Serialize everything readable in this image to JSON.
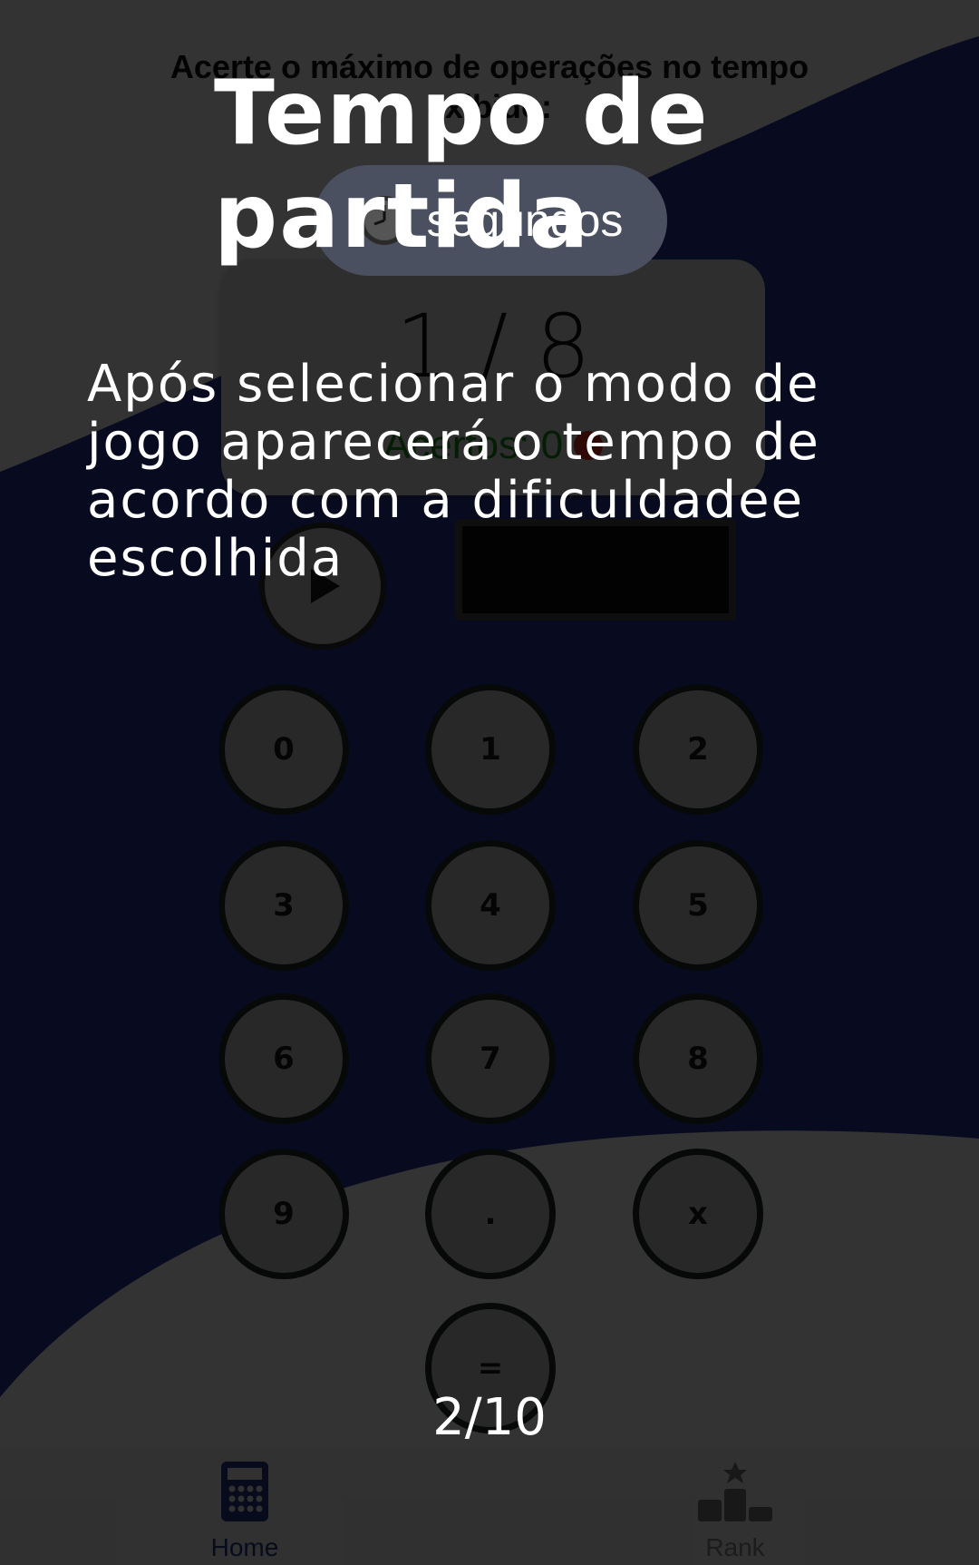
{
  "game": {
    "instruction": "Acerte o máximo de operações no tempo exibido:",
    "timer_label": "segundos",
    "round_counter": "1 / 8",
    "hits_label": "Acertos: 0",
    "keypad": [
      "0",
      "1",
      "2",
      "3",
      "4",
      "5",
      "6",
      "7",
      "8",
      "9",
      ".",
      "x",
      "="
    ]
  },
  "nav": {
    "home_label": "Home",
    "rank_label": "Rank"
  },
  "tutorial": {
    "title": "Tempo de partida",
    "body": "Após selecionar o modo de jogo aparecerá o tempo de acordo com a dificuldadee escolhida",
    "step": "2/10"
  },
  "colors": {
    "background_wave": "#2c3a9c",
    "hits_text": "#1a8a1a",
    "hits_dot": "#e53020",
    "active_nav": "#2a3a8c"
  },
  "icons": {
    "timer": "clock-icon",
    "play": "play-icon",
    "home": "calculator-icon",
    "rank": "podium-icon"
  }
}
